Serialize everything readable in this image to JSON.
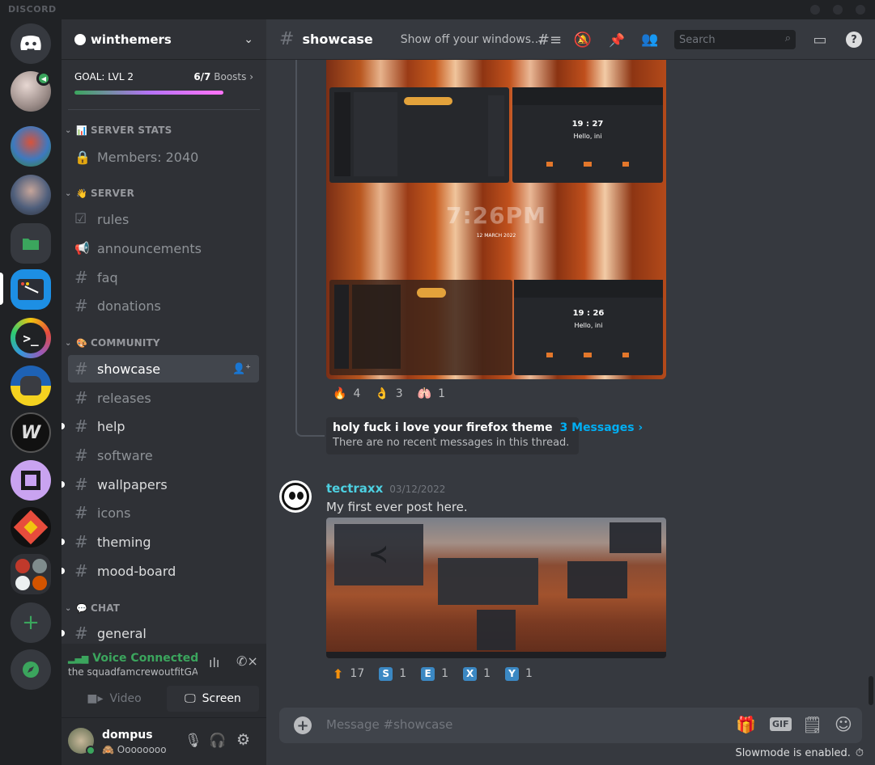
{
  "app": {
    "brand": "DISCORD"
  },
  "server": {
    "name": "winthemers",
    "boost_goal": "GOAL: LVL 2",
    "boost_count": "6/7",
    "boost_word": "Boosts",
    "boost_progress": 0.857
  },
  "categories": {
    "server_stats": "SERVER STATS",
    "server": "SERVER",
    "community": "COMMUNITY",
    "chat": "CHAT"
  },
  "channels": {
    "members": "Members: 2040",
    "rules": "rules",
    "announcements": "announcements",
    "faq": "faq",
    "donations": "donations",
    "showcase": "showcase",
    "releases": "releases",
    "help": "help",
    "software": "software",
    "wallpapers": "wallpapers",
    "icons": "icons",
    "theming": "theming",
    "mood_board": "mood-board",
    "general": "general"
  },
  "voice": {
    "status": "Voice Connected",
    "channel": "the squadfamcrewoutfitGA...",
    "video_label": "Video",
    "screen_label": "Screen"
  },
  "user": {
    "name": "dompus",
    "status": "Oooooooo"
  },
  "header": {
    "channel": "showcase",
    "topic": "Show off your windows ric...",
    "search_placeholder": "Search"
  },
  "screenshot1": {
    "clock1": "19 : 27",
    "greet1": "Hello, ini",
    "big_time": "7:26PM",
    "date": "12 MARCH 2022",
    "clock2": "19 : 26",
    "greet2": "Hello, ini"
  },
  "reactions1": [
    {
      "emoji": "fire",
      "count": "4"
    },
    {
      "emoji": "ok-hand",
      "count": "3"
    },
    {
      "emoji": "lungs",
      "count": "1"
    }
  ],
  "thread": {
    "title": "holy fuck i love your firefox theme",
    "link": "3 Messages ›",
    "sub": "There are no recent messages in this thread."
  },
  "message2": {
    "author": "tectraxx",
    "timestamp": "03/12/2022",
    "text": "My first ever post here."
  },
  "reactions2": [
    {
      "emoji": "up-arrow",
      "count": "17"
    },
    {
      "emoji": "S",
      "count": "1"
    },
    {
      "emoji": "E",
      "count": "1"
    },
    {
      "emoji": "X",
      "count": "1"
    },
    {
      "emoji": "Y",
      "count": "1"
    }
  ],
  "composer": {
    "placeholder": "Message #showcase",
    "gif": "GIF"
  },
  "slowmode": "Slowmode is enabled."
}
